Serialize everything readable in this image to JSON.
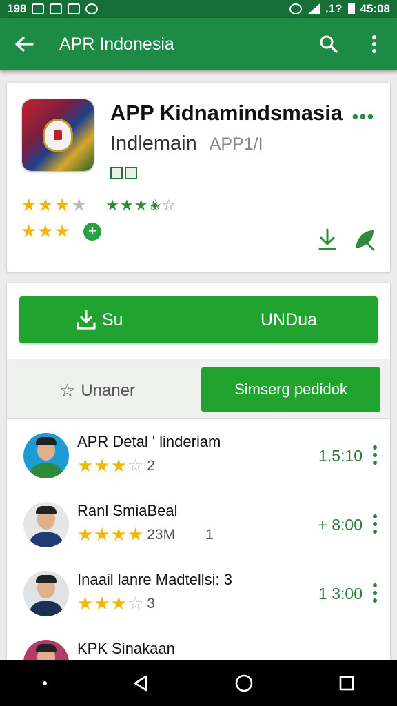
{
  "status_bar": {
    "left_text": "198",
    "left_sub": "ᴺᴳ",
    "right_text": "45:08",
    "signal_text": ".1?"
  },
  "app_bar": {
    "title": "APR Indonesia"
  },
  "app_card": {
    "title": "APP Kidnamindsmasia",
    "subtitle": "Indlemain",
    "subtitle_muted": "APP1/I",
    "more_label": "•••",
    "rating_stars_primary": 3,
    "rating_stars_secondary": 3.5,
    "rating_stars_third": 3
  },
  "download_button": {
    "left_label": "Su",
    "right_label": "UNDua"
  },
  "tabs": {
    "left_label": "Unaner",
    "right_label": "Simserg pedidok"
  },
  "list": [
    {
      "name": "APR Detal ' linderiam",
      "stars": 3,
      "count": "2",
      "extra": "",
      "time": "1.5:10",
      "avatar_bg": "#1e9bd7",
      "shirt": "#2d8a3a"
    },
    {
      "name": "Ranl SmiaBeal",
      "stars": 4,
      "count": "23M",
      "extra": "1",
      "time": "+ 8:00",
      "avatar_bg": "#e6e6e6",
      "shirt": "#1f3b73"
    },
    {
      "name": "Inaail lanre Madtellsi: 3",
      "stars": 3,
      "count": "3",
      "extra": "",
      "time": "1 3:00",
      "avatar_bg": "#dfe3e6",
      "shirt": "#1c2f55"
    },
    {
      "name": "KPK Sinakaan",
      "stars": 0,
      "count": "",
      "extra": "",
      "time": "",
      "avatar_bg": "#b43a6b",
      "shirt": "#333333"
    }
  ],
  "colors": {
    "primary": "#1d8a46",
    "status": "#156f37",
    "accent": "#21a32f",
    "star": "#f2b705"
  }
}
